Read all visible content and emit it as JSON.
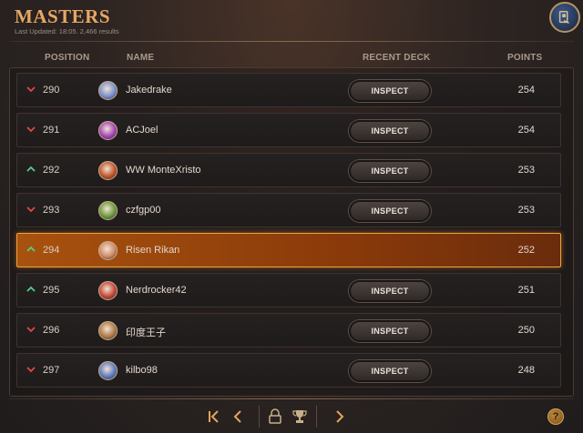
{
  "header": {
    "title": "MASTERS",
    "subtitle": "Last Updated: 18:05. 2,466 results"
  },
  "columns": {
    "position": "POSITION",
    "name": "NAME",
    "recent_deck": "RECENT DECK",
    "points": "POINTS"
  },
  "rows": [
    {
      "position": "290",
      "name": "Jakedrake",
      "points": "254",
      "trend": "down",
      "inspect_label": "INSPECT",
      "avatar_color": "#7a8fd0"
    },
    {
      "position": "291",
      "name": "ACJoel",
      "points": "254",
      "trend": "down",
      "inspect_label": "INSPECT",
      "avatar_color": "#a445b8"
    },
    {
      "position": "292",
      "name": "WW MonteXristo",
      "points": "253",
      "trend": "up",
      "inspect_label": "INSPECT",
      "avatar_color": "#c0542c"
    },
    {
      "position": "293",
      "name": "czfgp00",
      "points": "253",
      "trend": "down",
      "inspect_label": "INSPECT",
      "avatar_color": "#6b9a3c"
    },
    {
      "position": "294",
      "name": "Risen Rikan",
      "points": "252",
      "trend": "up",
      "inspect_label": "",
      "avatar_color": "#d08a6a"
    },
    {
      "position": "295",
      "name": "Nerdrocker42",
      "points": "251",
      "trend": "up",
      "inspect_label": "INSPECT",
      "avatar_color": "#c4463a"
    },
    {
      "position": "296",
      "name": "印度王子",
      "points": "250",
      "trend": "down",
      "inspect_label": "INSPECT",
      "avatar_color": "#b07a4a"
    },
    {
      "position": "297",
      "name": "kilbo98",
      "points": "248",
      "trend": "down",
      "inspect_label": "INSPECT",
      "avatar_color": "#5d7ac0"
    }
  ],
  "colors": {
    "accent": "#e6a865",
    "highlight_border": "#f0a23c",
    "trend_up": "#4fd08a",
    "trend_down": "#e04848"
  },
  "icons": {
    "logo": "legends-of-runeterra-logo-icon",
    "first": "first-page-icon",
    "prev": "previous-page-icon",
    "lock": "lock-icon",
    "trophy": "trophy-icon",
    "next": "next-page-icon",
    "help": "help-icon"
  },
  "help_label": "?"
}
